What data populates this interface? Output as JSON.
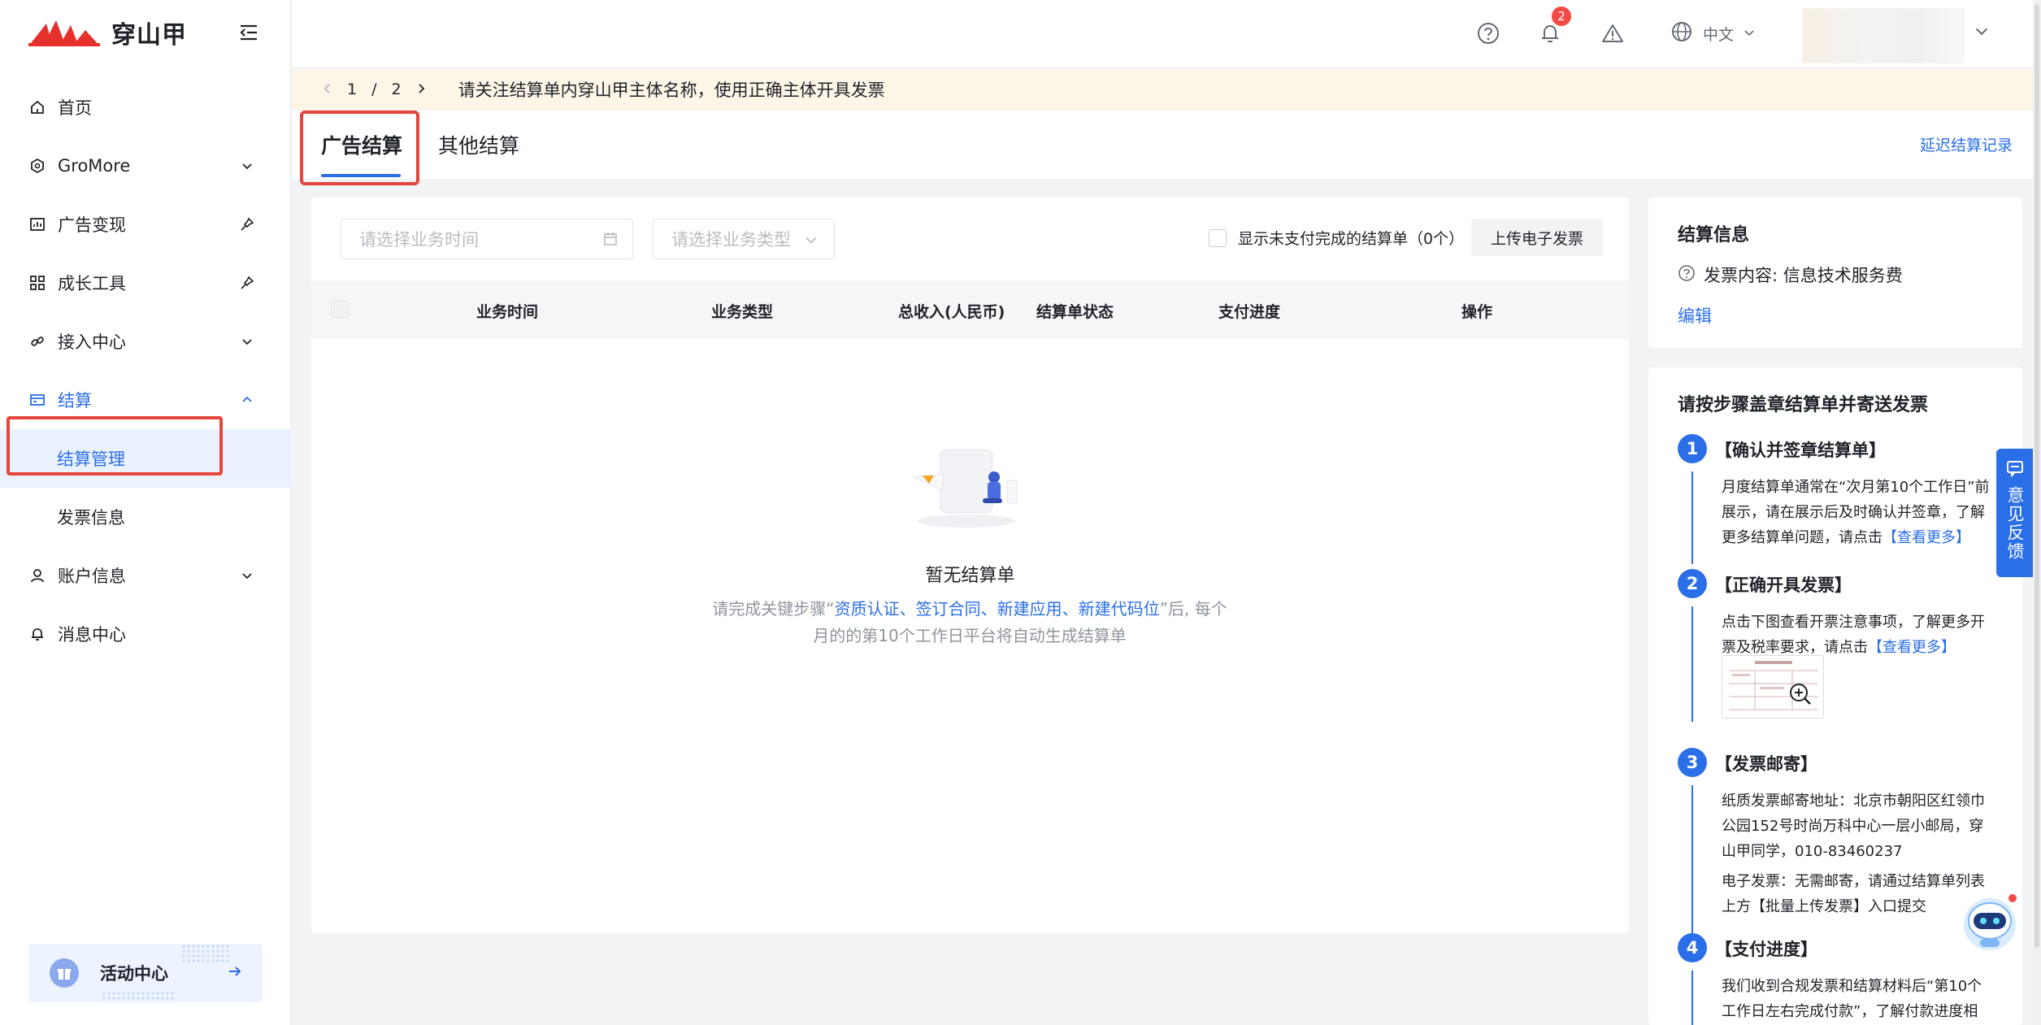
{
  "app": {
    "brand_name": "穿山甲",
    "brand_color": "#e5302b",
    "accent_color": "#2a6ee8"
  },
  "sidebar": {
    "items": [
      {
        "label": "首页",
        "icon": "home-icon"
      },
      {
        "label": "GroMore",
        "icon": "gromore-icon",
        "trailing": "chevron-down-icon"
      },
      {
        "label": "广告变现",
        "icon": "chart-icon",
        "trailing": "pin-icon"
      },
      {
        "label": "成长工具",
        "icon": "grid-icon",
        "trailing": "pin-icon"
      },
      {
        "label": "接入中心",
        "icon": "link-icon",
        "trailing": "chevron-down-icon"
      },
      {
        "label": "结算",
        "icon": "card-icon",
        "trailing": "chevron-up-icon",
        "expanded": true
      },
      {
        "label": "结算管理",
        "selected": true
      },
      {
        "label": "发票信息"
      },
      {
        "label": "账户信息",
        "icon": "user-icon",
        "trailing": "chevron-down-icon"
      },
      {
        "label": "消息中心",
        "icon": "bell-icon"
      }
    ],
    "activity_label": "活动中心"
  },
  "header": {
    "notification_count": "2",
    "language": "中文"
  },
  "notice": {
    "page_current": "1",
    "page_sep": "/",
    "page_total": "2",
    "message": "请关注结算单内穿山甲主体名称，使用正确主体开具发票"
  },
  "tabs": {
    "items": [
      "广告结算",
      "其他结算"
    ],
    "active": "广告结算",
    "right_link": "延迟结算记录"
  },
  "filters": {
    "date_placeholder": "请选择业务时间",
    "type_placeholder": "请选择业务类型",
    "unpaid_label": "显示未支付完成的结算单（0个）",
    "upload_label": "上传电子发票"
  },
  "table": {
    "columns": [
      "业务时间",
      "业务类型",
      "总收入(人民币)",
      "结算单状态",
      "支付进度",
      "操作"
    ],
    "rows": []
  },
  "empty": {
    "title": "暂无结算单",
    "desc_prefix": "请完成关键步骤“",
    "desc_links": "资质认证、签订合同、新建应用、新建代码位",
    "desc_suffix": "”后, 每个",
    "desc_line2": "月的的第10个工作日平台将自动生成结算单"
  },
  "settlement_info": {
    "title": "结算信息",
    "invoice_content": "发票内容: 信息技术服务费",
    "edit_label": "编辑"
  },
  "steps": {
    "title": "请按步骤盖章结算单并寄送发票",
    "items": [
      {
        "num": "1",
        "head": "【确认并签章结算单】",
        "line1": "月度结算单通常在“次月第10个工作日”前",
        "line2": "展示，请在展示后及时确认并签章，了解",
        "line3": "更多结算单问题，请点击",
        "link": "【查看更多】"
      },
      {
        "num": "2",
        "head": "【正确开具发票】",
        "line1": "点击下图查看开票注意事项，了解更多开",
        "line2": "票及税率要求，请点击",
        "link": "【查看更多】"
      },
      {
        "num": "3",
        "head": "【发票邮寄】",
        "line1": "纸质发票邮寄地址：北京市朝阳区红领巾",
        "line2": "公园152号时尚万科中心一层小邮局，穿",
        "line3": "山甲同学，010-83460237",
        "line4": "电子发票：无需邮寄，请通过结算单列表",
        "line5": "上方【批量上传发票】入口提交"
      },
      {
        "num": "4",
        "head": "【支付进度】",
        "line1": "我们收到合规发票和结算材料后“第10个",
        "line2": "工作日左右完成付款”，了解付款进度相"
      }
    ]
  },
  "feedback": {
    "label": "意见反馈"
  }
}
